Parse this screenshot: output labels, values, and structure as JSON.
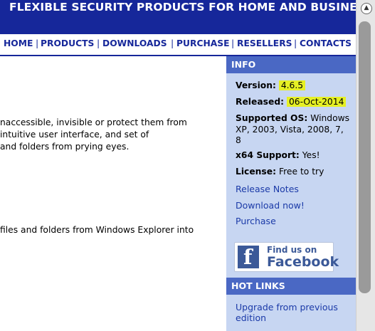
{
  "header": {
    "title": "FLEXIBLE SECURITY PRODUCTS FOR HOME AND BUSINESS"
  },
  "nav": {
    "items": [
      "HOME",
      "PRODUCTS",
      "DOWNLOADS",
      "PURCHASE",
      "RESELLERS",
      "CONTACTS"
    ],
    "separator": "|"
  },
  "content": {
    "lines": [
      "naccessible, invisible or protect them from",
      " intuitive user interface, and set of",
      "and folders from prying eyes.",
      " files and folders from Windows Explorer into"
    ]
  },
  "sidebar": {
    "info_heading": "INFO",
    "version_label": "Version:",
    "version_value": "4.6.5",
    "released_label": "Released:",
    "released_value": "06-Oct-2014",
    "supported_os_label": "Supported OS:",
    "supported_os_value_1": "Windows",
    "supported_os_value_2": "XP, 2003, Vista, 2008, 7,",
    "supported_os_value_3": "8",
    "x64_label": "x64 Support:",
    "x64_value": "Yes!",
    "license_label": "License:",
    "license_value": "Free to try",
    "links": [
      "Release Notes",
      "Download now!",
      "Purchase"
    ],
    "facebook": {
      "logo_letter": "f",
      "line1": "Find us on",
      "line2": "Facebook"
    },
    "hotlinks_heading": "HOT LINKS",
    "hotlink_1_line1": "Upgrade from previous",
    "hotlink_1_line2": "edition"
  },
  "colors": {
    "banner": "#16279a",
    "sidebar_bg": "#c7d6f2",
    "sidebar_heading": "#4a68c4",
    "highlight": "#e6f024",
    "link": "#1b3aa8"
  }
}
